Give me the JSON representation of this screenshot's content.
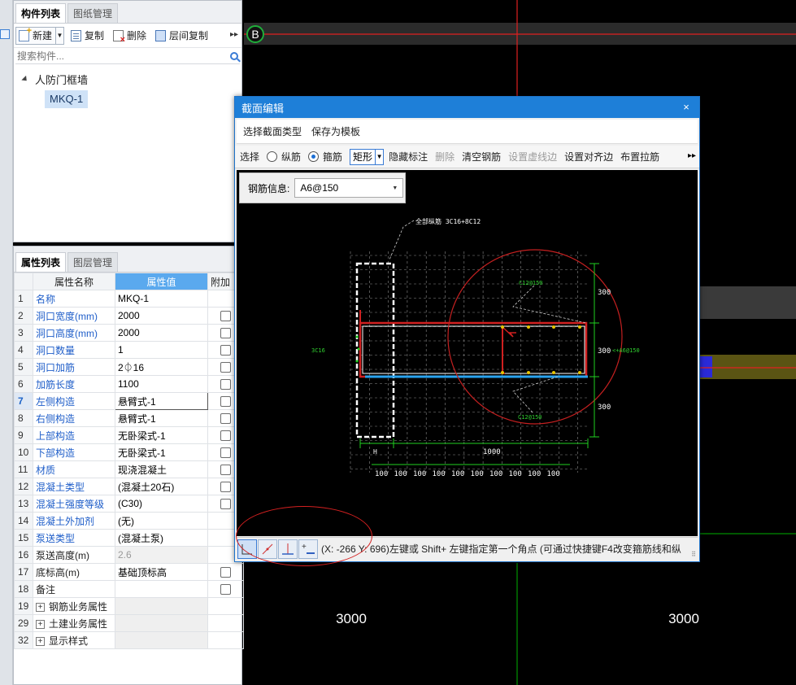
{
  "component_panel": {
    "tabs": [
      "构件列表",
      "图纸管理"
    ],
    "toolbar": {
      "new_label": "新建",
      "copy_label": "复制",
      "delete_label": "删除",
      "floor_copy_label": "层间复制"
    },
    "search_placeholder": "搜索构件...",
    "tree": {
      "root_label": "人防门框墙",
      "child_label": "MKQ-1"
    }
  },
  "property_panel": {
    "tabs": [
      "属性列表",
      "图层管理"
    ],
    "headers": {
      "name": "属性名称",
      "value": "属性值",
      "extra": "附加"
    },
    "rows": [
      {
        "num": "1",
        "name": "名称",
        "value": "MKQ-1",
        "checkbox": false
      },
      {
        "num": "2",
        "name": "洞口宽度(mm)",
        "value": "2000",
        "checkbox": true
      },
      {
        "num": "3",
        "name": "洞口高度(mm)",
        "value": "2000",
        "checkbox": true
      },
      {
        "num": "4",
        "name": "洞口数量",
        "value": "1",
        "checkbox": true
      },
      {
        "num": "5",
        "name": "洞口加筋",
        "value": "2⏀16",
        "checkbox": true
      },
      {
        "num": "6",
        "name": "加筋长度",
        "value": "1100",
        "checkbox": true
      },
      {
        "num": "7",
        "name": "左侧构造",
        "value": "悬臂式-1",
        "checkbox": true
      },
      {
        "num": "8",
        "name": "右侧构造",
        "value": "悬臂式-1",
        "checkbox": true
      },
      {
        "num": "9",
        "name": "上部构造",
        "value": "无卧梁式-1",
        "checkbox": true
      },
      {
        "num": "10",
        "name": "下部构造",
        "value": "无卧梁式-1",
        "checkbox": true
      },
      {
        "num": "11",
        "name": "材质",
        "value": "现浇混凝土",
        "checkbox": true
      },
      {
        "num": "12",
        "name": "混凝土类型",
        "value": "(混凝土20石)",
        "checkbox": true
      },
      {
        "num": "13",
        "name": "混凝土强度等级",
        "value": "(C30)",
        "checkbox": true
      },
      {
        "num": "14",
        "name": "混凝土外加剂",
        "value": "(无)",
        "checkbox": false
      },
      {
        "num": "15",
        "name": "泵送类型",
        "value": "(混凝土泵)",
        "checkbox": false
      },
      {
        "num": "16",
        "name": "泵送高度(m)",
        "value": "2.6",
        "checkbox": false
      },
      {
        "num": "17",
        "name": "底标高(m)",
        "value": "基础顶标高",
        "checkbox": true
      },
      {
        "num": "18",
        "name": "备注",
        "value": "",
        "checkbox": true
      }
    ],
    "groups": [
      {
        "num": "19",
        "name": "钢筋业务属性"
      },
      {
        "num": "29",
        "name": "土建业务属性"
      },
      {
        "num": "32",
        "name": "显示样式"
      }
    ]
  },
  "canvas": {
    "axis_label": "B",
    "dim_left": "3000",
    "dim_right": "3000"
  },
  "dialog": {
    "title": "截面编辑",
    "close_glyph": "×",
    "menu": [
      "选择截面类型",
      "保存为模板"
    ],
    "toolbar": {
      "select": "选择",
      "longitudinal": "纵筋",
      "stirrup": "箍筋",
      "shape": "矩形",
      "hide_mark": "隐藏标注",
      "delete": "删除",
      "clear_rebar": "清空钢筋",
      "set_virtual_edge": "设置虚线边",
      "set_align_edge": "设置对齐边",
      "place_tie": "布置拉筋"
    },
    "rebar_info_label": "钢筋信息:",
    "rebar_info_value": "A6@150",
    "drawing": {
      "all_longitudinal_note": "全部纵筋  3C16+8C12",
      "stirrup_top": "C12@150",
      "stirrup_bottom": "C12@150",
      "left_note": "3C16",
      "right_note": "<+A6@150",
      "dim_300_top": "300",
      "dim_300_mid": "300",
      "dim_300_bottom": "300",
      "dim_1000": "1000",
      "dim_H": "H",
      "grid_100": [
        "100",
        "100",
        "100",
        "100",
        "100",
        "100",
        "100",
        "100",
        "100",
        "100"
      ]
    },
    "status_text": "(X: -266 Y: 696)左键或 Shift+ 左键指定第一个角点 (可通过快捷键F4改变箍筋线和纵"
  },
  "colors": {
    "dialog_title_bg": "#1e7fd8",
    "selected_header": "#5aa9ee",
    "link_text": "#1f5ec9",
    "axis_red": "#e02020",
    "axis_green": "#00b000"
  }
}
